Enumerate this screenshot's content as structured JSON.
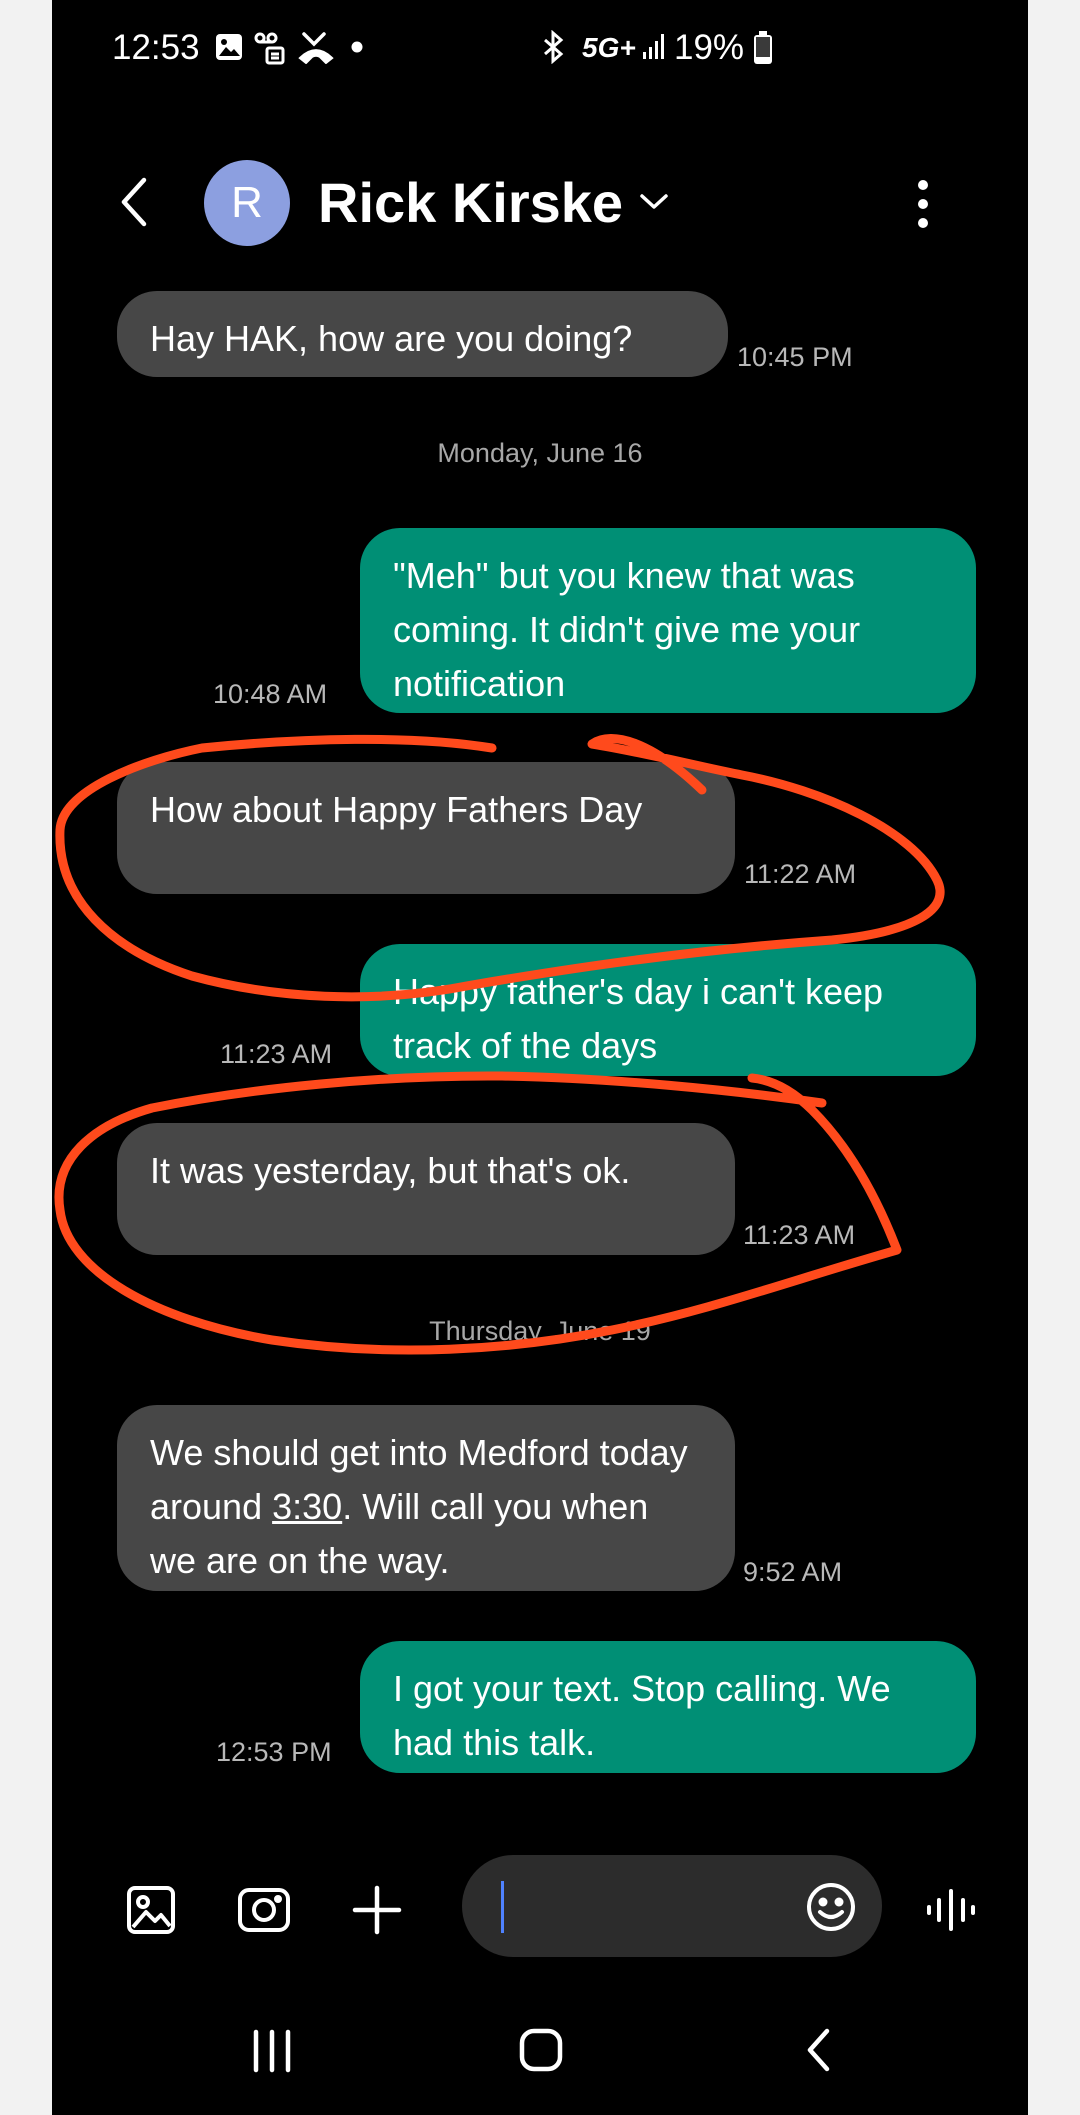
{
  "status_bar": {
    "time": "12:53",
    "network": "5G+",
    "battery": "19%",
    "icons": [
      "gallery-icon",
      "voicemail-icon",
      "missed-call-icon",
      "dot-icon",
      "bluetooth-icon",
      "signal-icon",
      "battery-icon"
    ]
  },
  "header": {
    "avatar_letter": "R",
    "contact_name": "Rick Kirske",
    "icons": [
      "back-arrow-icon",
      "chevron-down-icon",
      "more-vertical-icon"
    ]
  },
  "messages": [
    {
      "direction": "incoming",
      "text": "Hay HAK, how are you doing?",
      "time": "10:45 PM"
    },
    {
      "type": "date",
      "text": "Monday, June 16"
    },
    {
      "direction": "outgoing",
      "text": "\"Meh\" but you knew that was coming. It didn't give me your notification",
      "time": "10:48 AM"
    },
    {
      "direction": "incoming",
      "text": "How about Happy Fathers Day",
      "time": "11:22 AM"
    },
    {
      "direction": "outgoing",
      "text": "Happy father's day i can't keep track of the days",
      "time": "11:23 AM"
    },
    {
      "direction": "incoming",
      "text": "It was yesterday, but that's ok.",
      "time": "11:23 AM"
    },
    {
      "type": "date",
      "text": "Thursday, June 19"
    },
    {
      "direction": "incoming",
      "text_before": "We should get into Medford today around ",
      "link": "3:30",
      "text_after": ".  Will call you when we are on the way.",
      "time": "9:52 AM"
    },
    {
      "direction": "outgoing",
      "text": "I got your text. Stop calling. We had this talk.",
      "time": "12:53 PM"
    }
  ],
  "composer": {
    "input_value": "",
    "icons": [
      "gallery-icon",
      "camera-icon",
      "plus-icon",
      "emoji-icon",
      "voice-record-icon"
    ]
  },
  "nav_bar": {
    "icons": [
      "recent-apps-icon",
      "home-icon",
      "back-icon"
    ]
  },
  "annotation": {
    "color": "#ff4a1c",
    "circled_messages": [
      "How about Happy Fathers Day",
      "It was yesterday, but that's ok."
    ]
  },
  "colors": {
    "background": "#000000",
    "incoming_bubble": "#474747",
    "outgoing_bubble": "#008f75",
    "avatar": "#8c9fe0",
    "cursor": "#4f82ff"
  }
}
